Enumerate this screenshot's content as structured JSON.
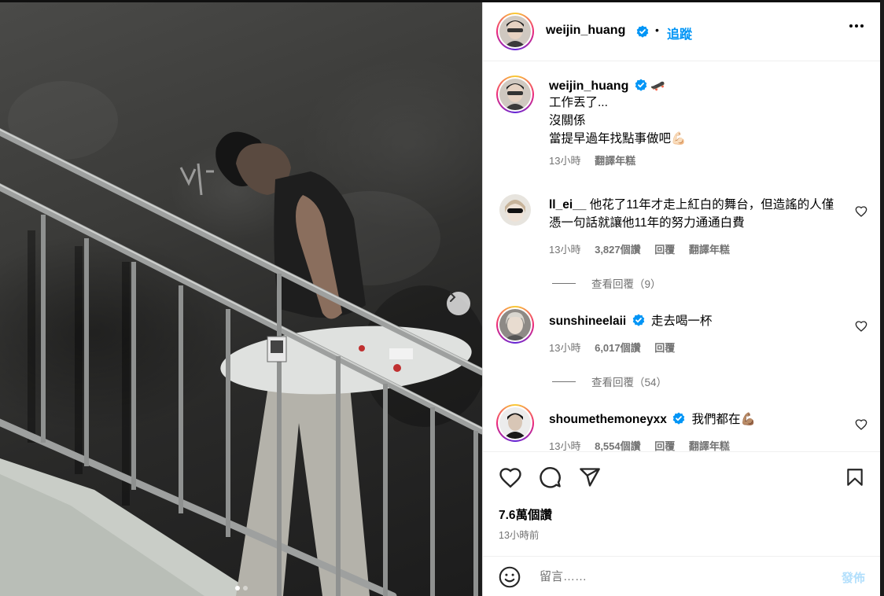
{
  "post": {
    "username": "weijin_huang",
    "follow_label": "追蹤",
    "separator": "•",
    "caption_lines": [
      "工作丟了...",
      "沒關係",
      "當提早過年找點事做吧💪🏻"
    ],
    "caption_emoji": "🛹",
    "caption_time": "13小時",
    "caption_translate": "翻譯年糕"
  },
  "comments": [
    {
      "username": "ll_ei__",
      "text": "他花了11年才走上紅白的舞台，但造謠的人僅憑一句話就讓他11年的努力通通白費",
      "time": "13小時",
      "likes": "3,827個讚",
      "reply": "回覆",
      "translate": "翻譯年糕",
      "view_replies": "查看回覆（9）"
    },
    {
      "username": "sunshineelaii",
      "text": "走去喝一杯",
      "time": "13小時",
      "likes": "6,017個讚",
      "reply": "回覆",
      "view_replies": "查看回覆（54）"
    },
    {
      "username": "shoumethemoneyxx",
      "text": "我們都在💪🏽",
      "time": "13小時",
      "likes": "8,554個讚",
      "reply": "回覆",
      "translate": "翻譯年糕"
    }
  ],
  "stats": {
    "likes": "7.6萬個讚",
    "time_ago": "13小時前"
  },
  "composer": {
    "placeholder": "留言……",
    "post_label": "發佈"
  },
  "icons": {
    "like": "heart-icon",
    "comment": "comment-icon",
    "share": "paper-plane-icon",
    "save": "bookmark-icon",
    "more": "more-dots-icon",
    "verified": "verified-badge-icon",
    "emoji": "emoji-smiley-icon",
    "next": "chevron-right-icon"
  },
  "colors": {
    "link": "#0095f6",
    "verified": "#0095f6",
    "muted": "#737373",
    "post_disabled": "#b2dffc"
  }
}
